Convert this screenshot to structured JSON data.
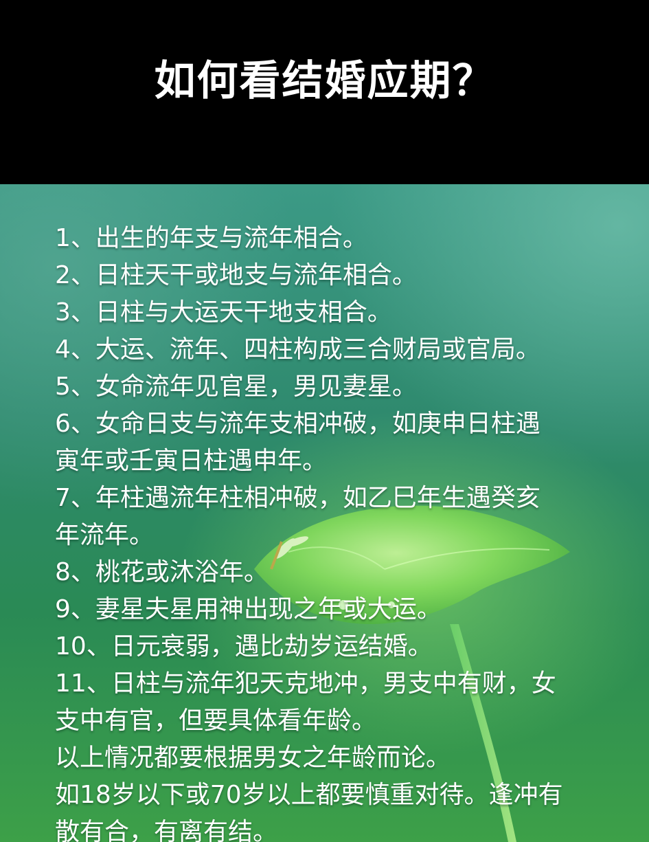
{
  "title": "如何看结婚应期？",
  "lines": [
    "1、出生的年支与流年相合。",
    "2、日柱天干或地支与流年相合。",
    "3、日柱与大运天干地支相合。",
    "4、大运、流年、四柱构成三合财局或官局。",
    "5、女命流年见官星，男见妻星。",
    "6、女命日支与流年支相冲破，如庚申日柱遇",
    "寅年或壬寅日柱遇申年。",
    "7、年柱遇流年柱相冲破，如乙巳年生遇癸亥",
    "年流年。",
    "8、桃花或沐浴年。",
    "9、妻星夫星用神出现之年或大运。",
    "10、日元衰弱，遇比劫岁运结婚。",
    "11、日柱与流年犯天克地冲，男支中有财，女",
    "支中有官，但要具体看年龄。",
    "以上情况都要根据男女之年龄而论。",
    "如18岁以下或70岁以上都要慎重对待。逢冲有",
    "散有合，有离有结。"
  ],
  "colors": {
    "header_bg": "#000000",
    "text": "#ffffff",
    "bg_green": "#2f8a6e",
    "leaf": "#8ee06a"
  }
}
